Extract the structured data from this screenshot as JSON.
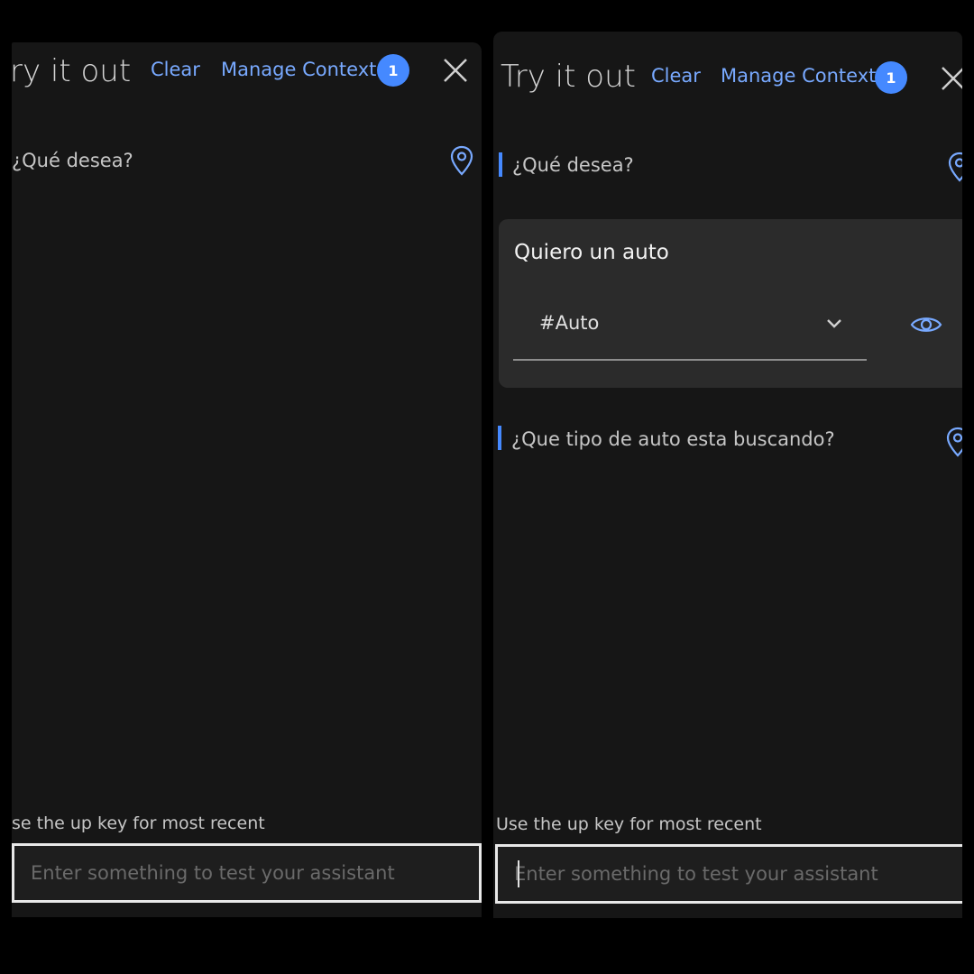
{
  "left": {
    "header": {
      "title": "ry it out",
      "clear_label": "Clear",
      "manage_label": "Manage Context",
      "badge": "1"
    },
    "messages": [
      "¿Qué desea?"
    ],
    "hint": "se the up key for most recent",
    "input": {
      "placeholder": "Enter something to test your assistant",
      "value": ""
    }
  },
  "right": {
    "header": {
      "title": "Try it out",
      "clear_label": "Clear",
      "manage_label": "Manage Context",
      "badge": "1"
    },
    "messages": [
      "¿Qué desea?",
      "¿Que tipo de auto esta buscando?"
    ],
    "card": {
      "text": "Quiero un auto",
      "intent": "#Auto"
    },
    "hint": "Use the up key for most recent",
    "input": {
      "placeholder": "Enter something to test your assistant",
      "value": ""
    }
  },
  "icons": [
    "close-icon",
    "location-pin-icon",
    "chevron-down-icon",
    "eye-icon"
  ],
  "colors": {
    "accent": "#78a9ff",
    "badge": "#4589ff",
    "panel": "#161616",
    "card": "#2b2b2b"
  }
}
